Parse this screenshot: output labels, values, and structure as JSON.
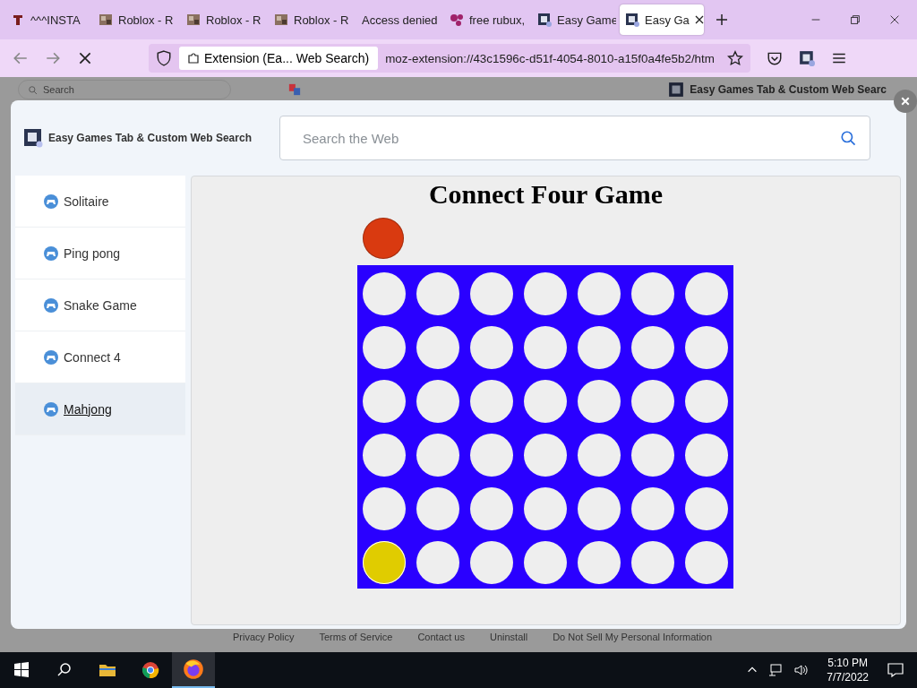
{
  "browser": {
    "tabs": [
      {
        "title": "^^^INSTA",
        "kind": "letter",
        "selected": false
      },
      {
        "title": "Roblox - R",
        "kind": "thumb",
        "selected": false
      },
      {
        "title": "Roblox - R",
        "kind": "thumb",
        "selected": false
      },
      {
        "title": "Roblox - R",
        "kind": "thumb",
        "selected": false
      },
      {
        "title": "Access denied",
        "kind": "plain",
        "selected": false
      },
      {
        "title": "free rubux,",
        "kind": "dots",
        "selected": false
      },
      {
        "title": "Easy Game",
        "kind": "app",
        "selected": false
      },
      {
        "title": "Easy Ga",
        "kind": "app",
        "selected": true
      }
    ],
    "identity": "Extension (Ea... Web Search)",
    "url": "moz-extension://43c1596c-d51f-4054-8010-a15f0a4fe5b2/htm"
  },
  "background_page": {
    "search_placeholder": "Search",
    "title": "Easy Games Tab & Custom Web Searc",
    "footer_links": [
      "Privacy Policy",
      "Terms of Service",
      "Contact us",
      "Uninstall",
      "Do Not Sell My Personal Information"
    ]
  },
  "modal": {
    "title": "Easy Games Tab & Custom Web Search",
    "search": {
      "placeholder": "Search the Web"
    },
    "games": [
      {
        "label": "Solitaire",
        "hovered": false
      },
      {
        "label": "Ping pong",
        "hovered": false
      },
      {
        "label": "Snake Game",
        "hovered": false
      },
      {
        "label": "Connect 4",
        "hovered": false
      },
      {
        "label": "Mahjong",
        "hovered": true
      }
    ],
    "game": {
      "title": "Connect Four Game",
      "next_piece": {
        "kind": "red"
      },
      "board": [
        [
          {
            "kind": "empty"
          },
          {
            "kind": "empty"
          },
          {
            "kind": "empty"
          },
          {
            "kind": "empty"
          },
          {
            "kind": "empty"
          },
          {
            "kind": "empty"
          },
          {
            "kind": "empty"
          }
        ],
        [
          {
            "kind": "empty"
          },
          {
            "kind": "empty"
          },
          {
            "kind": "empty"
          },
          {
            "kind": "empty"
          },
          {
            "kind": "empty"
          },
          {
            "kind": "empty"
          },
          {
            "kind": "empty"
          }
        ],
        [
          {
            "kind": "empty"
          },
          {
            "kind": "empty"
          },
          {
            "kind": "empty"
          },
          {
            "kind": "empty"
          },
          {
            "kind": "empty"
          },
          {
            "kind": "empty"
          },
          {
            "kind": "empty"
          }
        ],
        [
          {
            "kind": "empty"
          },
          {
            "kind": "empty"
          },
          {
            "kind": "empty"
          },
          {
            "kind": "empty"
          },
          {
            "kind": "empty"
          },
          {
            "kind": "empty"
          },
          {
            "kind": "empty"
          }
        ],
        [
          {
            "kind": "empty"
          },
          {
            "kind": "empty"
          },
          {
            "kind": "empty"
          },
          {
            "kind": "empty"
          },
          {
            "kind": "empty"
          },
          {
            "kind": "empty"
          },
          {
            "kind": "empty"
          }
        ],
        [
          {
            "kind": "yellow"
          },
          {
            "kind": "empty"
          },
          {
            "kind": "empty"
          },
          {
            "kind": "empty"
          },
          {
            "kind": "empty"
          },
          {
            "kind": "empty"
          },
          {
            "kind": "empty"
          }
        ]
      ]
    }
  },
  "taskbar": {
    "time": "5:10 PM",
    "date": "7/7/2022"
  }
}
